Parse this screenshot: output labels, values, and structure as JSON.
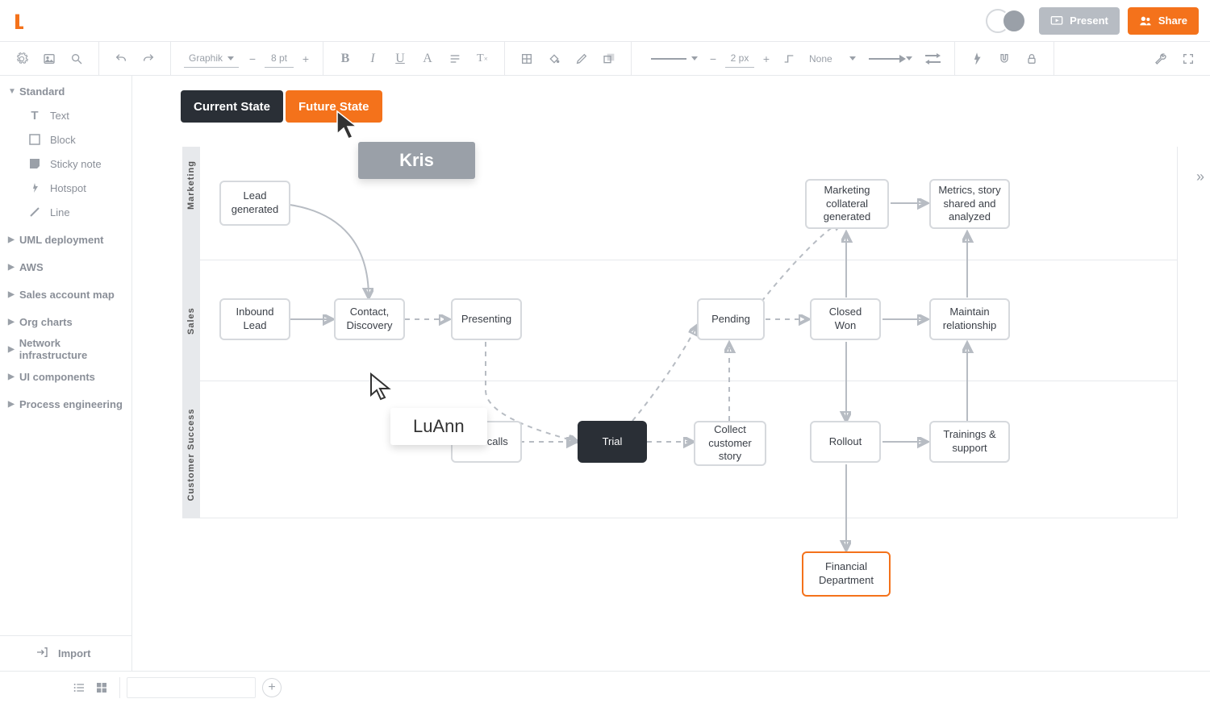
{
  "header": {
    "present_label": "Present",
    "share_label": "Share"
  },
  "toolbar": {
    "font_family": "Graphik",
    "font_size": "8 pt",
    "line_width": "2 px",
    "line_style_label": "None"
  },
  "sidebar": {
    "standard_label": "Standard",
    "shapes": [
      {
        "id": "text",
        "label": "Text"
      },
      {
        "id": "block",
        "label": "Block"
      },
      {
        "id": "sticky",
        "label": "Sticky note"
      },
      {
        "id": "hotspot",
        "label": "Hotspot"
      },
      {
        "id": "line",
        "label": "Line"
      }
    ],
    "libraries": [
      "UML deployment",
      "AWS",
      "Sales account map",
      "Org charts",
      "Network infrastructure",
      "UI components",
      "Process engineering"
    ],
    "import_label": "Import"
  },
  "layers": {
    "current_state": "Current State",
    "future_state": "Future State"
  },
  "collaborators": {
    "kris": "Kris",
    "luann": "LuAnn"
  },
  "swimlanes": {
    "marketing": "Marketing",
    "sales": "Sales",
    "customer_success": "Customer Success"
  },
  "nodes": {
    "lead_generated": "Lead generated",
    "marketing_collateral": "Marketing collateral generated",
    "metrics_story": "Metrics, story shared and analyzed",
    "inbound_lead": "Inbound Lead",
    "contact_discovery": "Contact, Discovery",
    "presenting": "Presenting",
    "pending": "Pending",
    "closed_won": "Closed Won",
    "maintain_relationship": "Maintain relationship",
    "join_calls": "Join calls",
    "trial": "Trial",
    "collect_story": "Collect customer story",
    "rollout": "Rollout",
    "trainings_support": "Trainings & support",
    "financial_department": "Financial Department"
  }
}
